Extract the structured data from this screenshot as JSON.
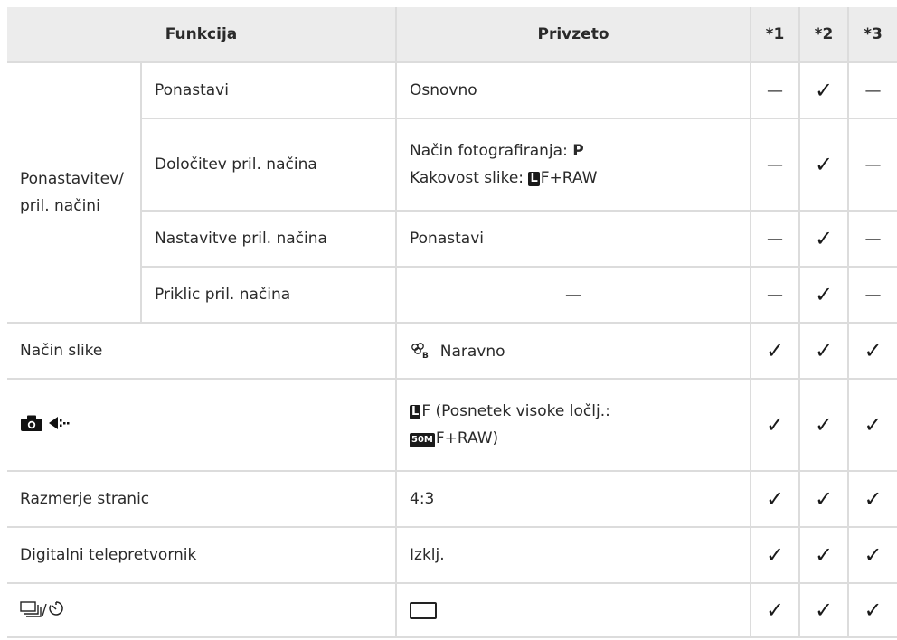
{
  "headers": {
    "function": "Funkcija",
    "default": "Privzeto",
    "c1": "*1",
    "c2": "*2",
    "c3": "*3"
  },
  "group": {
    "label_line1": "Ponastavitev/",
    "label_line2": "pril. načini"
  },
  "sub_rows": {
    "reset": {
      "name": "Ponastavi",
      "default": "Osnovno"
    },
    "assign": {
      "name": "Določitev pril. načina",
      "default_line1_label": "Način fotografiranja: ",
      "default_line1_value": "P",
      "default_line2_label": "Kakovost slike: ",
      "default_line2_badge": "L",
      "default_line2_value": "F+RAW"
    },
    "settings": {
      "name": "Nastavitve pril. načina",
      "default": "Ponastavi"
    },
    "recall": {
      "name": "Priklic pril. načina",
      "default": "—"
    }
  },
  "rows": {
    "picture_mode": {
      "name": "Način slike",
      "icon": "picture-mode-natural-icon",
      "default": "Naravno"
    },
    "quality": {
      "name_icons": "camera-icon + quality-icon",
      "line1_badge": "L",
      "line1_text": "F (Posnetek visoke ločlj.:",
      "line2_badge": "50M",
      "line2_text": "F+RAW)"
    },
    "aspect": {
      "name": "Razmerje stranic",
      "default": "4:3"
    },
    "teleconverter": {
      "name": "Digitalni telepretvornik",
      "default": "Izklj."
    },
    "drive": {
      "name_icons": "sequential-shooting-icon / self-timer-icon",
      "separator": "/",
      "default_icon": "single-frame-icon"
    }
  },
  "marks": {
    "check": "✓",
    "dash": "—"
  }
}
